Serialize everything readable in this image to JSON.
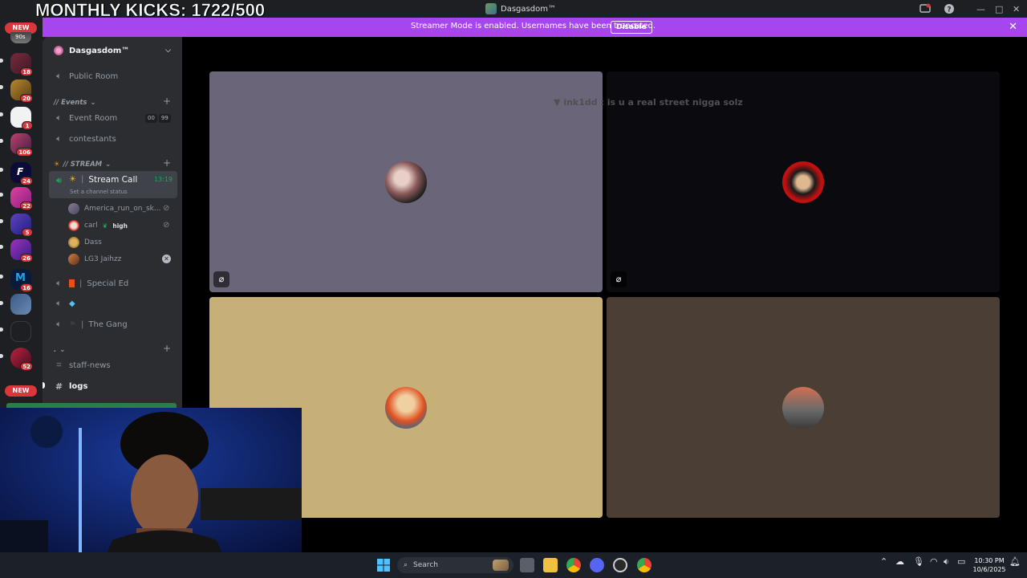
{
  "overlay": {
    "kicks_text": "MONTHLY KICKS: 1722/500"
  },
  "window": {
    "title": "Dasgasdom™"
  },
  "banner": {
    "text": "Streamer Mode is enabled. Usernames have been truncated.",
    "button": "Disable"
  },
  "rail": {
    "new_label": "NEW",
    "badges": [
      "18",
      "20",
      "1",
      "106",
      "24",
      "22",
      "5",
      "26",
      "16",
      "52"
    ],
    "server_label": "90s"
  },
  "guild": {
    "name": "Dasgasdom™"
  },
  "channels": {
    "public_room": "Public Room",
    "events_category": "// Events",
    "event_room": "Event Room",
    "event_room_count_a": "00",
    "event_room_count_b": "99",
    "contestants": "contestants",
    "stream_category": "// STREAM",
    "stream_call": "Stream Call",
    "stream_call_time": "13:19",
    "stream_call_status": "Set a channel status",
    "special_ed": "Special Ed",
    "the_gang": "The Gang",
    "misc_category": ".",
    "staff_news": "staff-news",
    "logs": "logs"
  },
  "voice_users": [
    {
      "name": "America_run_on_sk...",
      "tag": ""
    },
    {
      "name": "carl",
      "tag": "high"
    },
    {
      "name": "Dass",
      "tag": ""
    },
    {
      "name": "LG3 Jaihzz",
      "tag": ""
    }
  ],
  "stage": {
    "chat_overlay": "ink1dd : is u a real street nigga solz"
  },
  "taskbar": {
    "search_placeholder": "Search",
    "time": "10:30 PM",
    "date": "10/6/2025"
  },
  "colors": {
    "banner": "#a646ef",
    "tile1": "#6a6578",
    "tile2": "#0b0b0f",
    "tile3": "#c7b078",
    "tile4": "#4b3f35"
  }
}
